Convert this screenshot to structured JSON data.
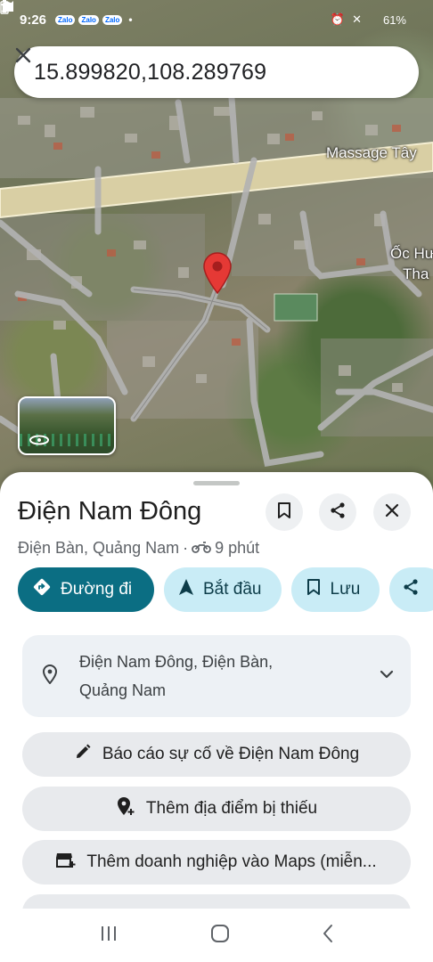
{
  "status_bar": {
    "time": "9:26",
    "app_badges": [
      "Zalo",
      "Zalo",
      "Zalo"
    ],
    "battery": "61%"
  },
  "search": {
    "value": "15.899820,108.289769"
  },
  "map": {
    "labels": [
      "Massage Tây",
      "Ốc Hư",
      "Tha"
    ]
  },
  "place": {
    "title": "Điện Nam Đông",
    "subtitle_location": "Điện Bàn, Quảng Nam",
    "subtitle_separator": "·",
    "travel_time": "9 phút"
  },
  "actions": {
    "directions": "Đường đi",
    "start": "Bắt đầu",
    "save": "Lưu"
  },
  "address": {
    "text": "Điện Nam Đông, Điện Bàn, Quảng Nam"
  },
  "options": {
    "report": "Báo cáo sự cố về Điện Nam Đông",
    "add_place": "Thêm địa điểm bị thiếu",
    "add_business": "Thêm doanh nghiệp vào Maps (miễn..."
  },
  "colors": {
    "primary_chip": "#0b6e83",
    "secondary_chip": "#c9ecf6",
    "pin": "#e53935"
  }
}
